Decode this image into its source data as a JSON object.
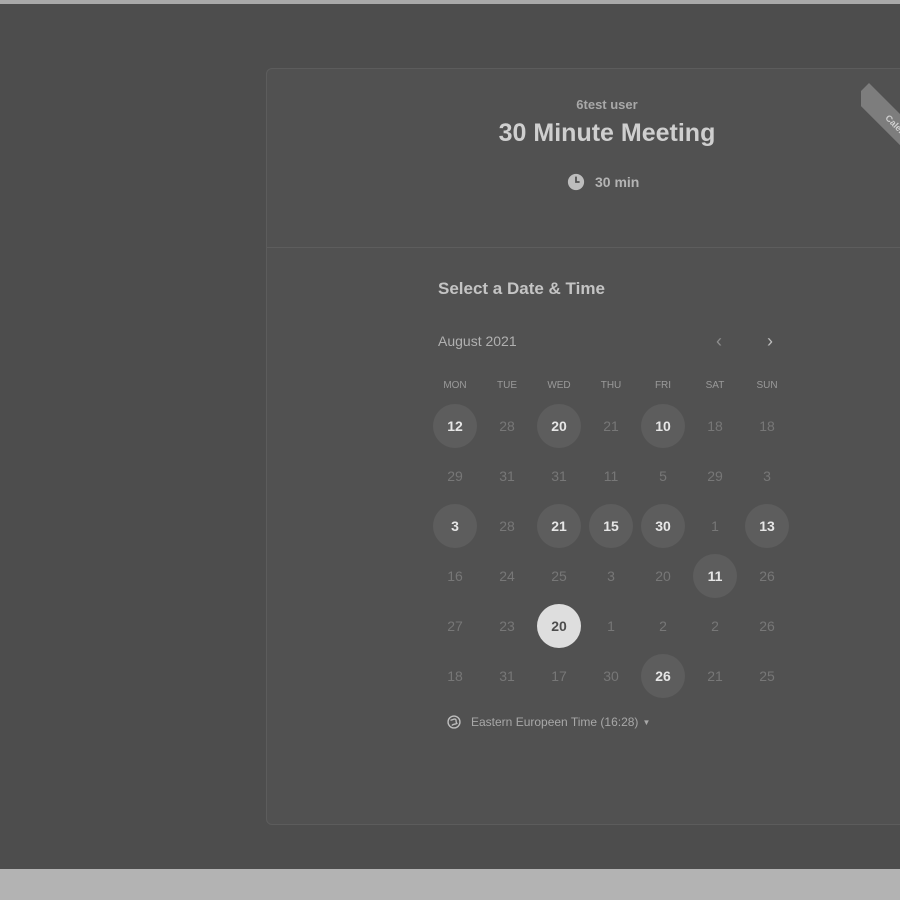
{
  "header": {
    "owner": "6test user",
    "title": "30 Minute Meeting",
    "duration": "30 min",
    "ribbon": "Calendly"
  },
  "calendar": {
    "section_title": "Select a Date & Time",
    "month_label": "August 2021",
    "weekdays": [
      "MON",
      "TUE",
      "WED",
      "THU",
      "FRI",
      "SAT",
      "SUN"
    ],
    "weeks": [
      [
        {
          "d": "12",
          "s": "available"
        },
        {
          "d": "28",
          "s": "disabled"
        },
        {
          "d": "20",
          "s": "available"
        },
        {
          "d": "21",
          "s": "disabled"
        },
        {
          "d": "10",
          "s": "available"
        },
        {
          "d": "18",
          "s": "disabled"
        },
        {
          "d": "18",
          "s": "disabled"
        }
      ],
      [
        {
          "d": "29",
          "s": "disabled"
        },
        {
          "d": "31",
          "s": "disabled"
        },
        {
          "d": "31",
          "s": "disabled"
        },
        {
          "d": "11",
          "s": "disabled"
        },
        {
          "d": "5",
          "s": "disabled"
        },
        {
          "d": "29",
          "s": "disabled"
        },
        {
          "d": "3",
          "s": "disabled"
        }
      ],
      [
        {
          "d": "3",
          "s": "available"
        },
        {
          "d": "28",
          "s": "disabled"
        },
        {
          "d": "21",
          "s": "available"
        },
        {
          "d": "15",
          "s": "available"
        },
        {
          "d": "30",
          "s": "available"
        },
        {
          "d": "1",
          "s": "disabled"
        },
        {
          "d": "13",
          "s": "available"
        }
      ],
      [
        {
          "d": "16",
          "s": "disabled"
        },
        {
          "d": "24",
          "s": "disabled"
        },
        {
          "d": "25",
          "s": "disabled"
        },
        {
          "d": "3",
          "s": "disabled"
        },
        {
          "d": "20",
          "s": "disabled"
        },
        {
          "d": "11",
          "s": "available"
        },
        {
          "d": "26",
          "s": "disabled"
        }
      ],
      [
        {
          "d": "27",
          "s": "disabled"
        },
        {
          "d": "23",
          "s": "disabled"
        },
        {
          "d": "20",
          "s": "selected"
        },
        {
          "d": "1",
          "s": "disabled"
        },
        {
          "d": "2",
          "s": "disabled"
        },
        {
          "d": "2",
          "s": "disabled"
        },
        {
          "d": "26",
          "s": "disabled"
        }
      ],
      [
        {
          "d": "18",
          "s": "disabled"
        },
        {
          "d": "31",
          "s": "disabled"
        },
        {
          "d": "17",
          "s": "disabled"
        },
        {
          "d": "30",
          "s": "disabled"
        },
        {
          "d": "26",
          "s": "available"
        },
        {
          "d": "21",
          "s": "disabled"
        },
        {
          "d": "25",
          "s": "disabled"
        }
      ]
    ],
    "timezone": "Eastern Europeen Time (16:28)"
  },
  "icons": {
    "clock": "clock-icon",
    "globe": "globe-icon",
    "prev": "chevron-left-icon",
    "next": "chevron-right-icon",
    "caret": "caret-down-icon"
  }
}
